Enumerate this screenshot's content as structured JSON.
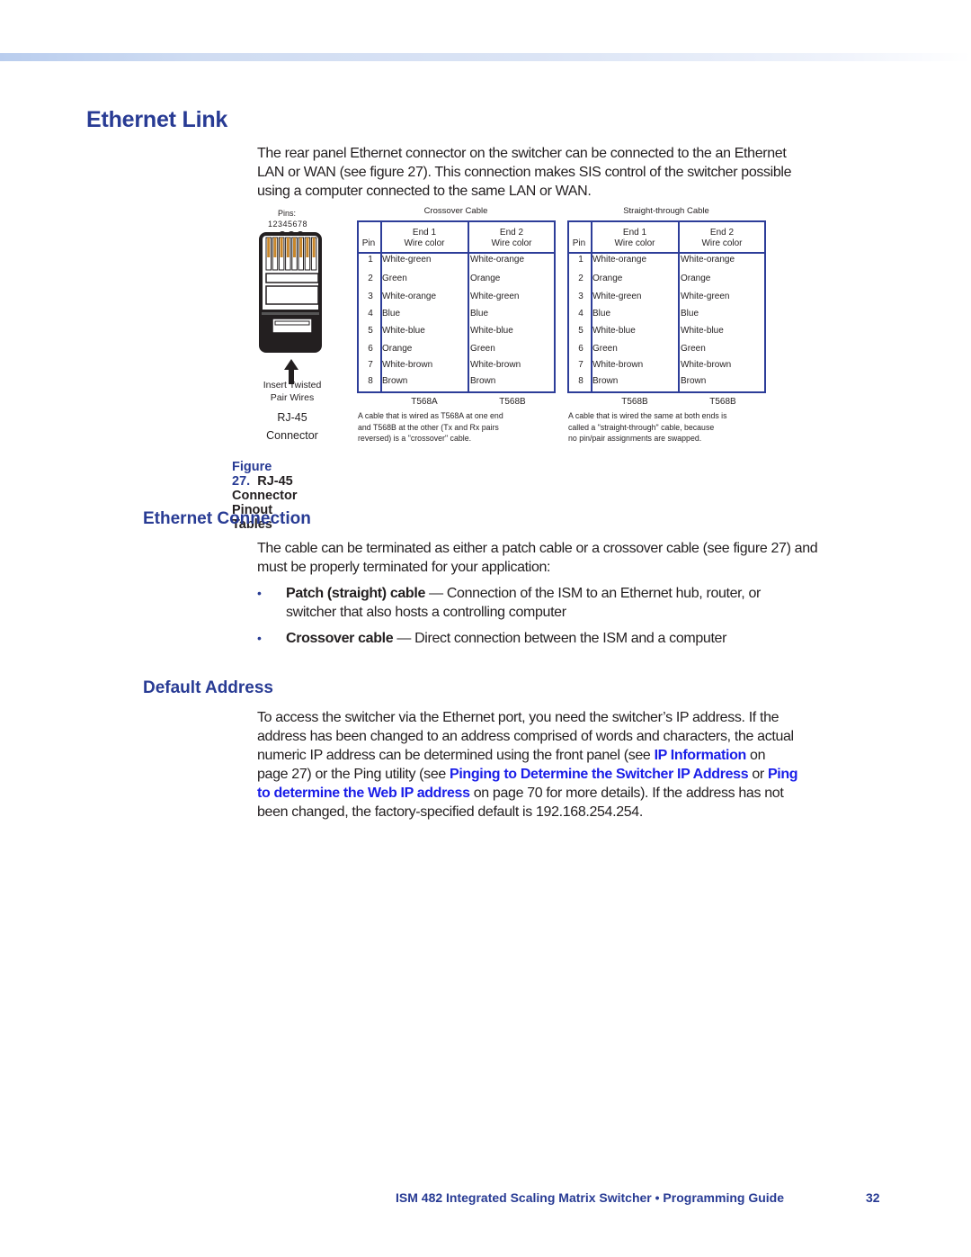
{
  "header": {
    "band": "gradient-band"
  },
  "section": {
    "title": "Ethernet Link",
    "intro": [
      "The rear panel Ethernet connector on the switcher can be connected to the an Ethernet",
      "LAN or WAN (see figure 27).  This connection makes SIS control of the switcher possible",
      "using a computer connected to the same LAN or WAN."
    ]
  },
  "figure": {
    "connector": {
      "pins_label": "Pins:",
      "pin_numbers": "12345678",
      "insert_label_1": "Insert Twisted",
      "insert_label_2": "Pair Wires",
      "name_1": "RJ-45",
      "name_2": "Connector",
      "pin_wire_color": "#c8862a"
    },
    "tables": [
      {
        "title": "Crossover Cable",
        "headers": {
          "pin": "Pin",
          "end1_a": "End 1",
          "end1_b": "Wire color",
          "end2_a": "End 2",
          "end2_b": "Wire color"
        },
        "rows": [
          {
            "pin": "1",
            "end1": "White-green",
            "end2": "White-orange"
          },
          {
            "pin": "2",
            "end1": "Green",
            "end2": "Orange"
          },
          {
            "pin": "3",
            "end1": "White-orange",
            "end2": "White-green"
          },
          {
            "pin": "4",
            "end1": "Blue",
            "end2": "Blue"
          },
          {
            "pin": "5",
            "end1": "White-blue",
            "end2": "White-blue"
          },
          {
            "pin": "6",
            "end1": "Orange",
            "end2": "Green"
          },
          {
            "pin": "7",
            "end1": "White-brown",
            "end2": "White-brown"
          },
          {
            "pin": "8",
            "end1": "Brown",
            "end2": "Brown"
          }
        ],
        "standard_end1": "T568A",
        "standard_end2": "T568B",
        "note": [
          "A cable that is wired as T568A at one end",
          "and T568B at the other (Tx and Rx pairs",
          "reversed) is a \"crossover\" cable."
        ]
      },
      {
        "title": "Straight-through Cable",
        "headers": {
          "pin": "Pin",
          "end1_a": "End 1",
          "end1_b": "Wire color",
          "end2_a": "End 2",
          "end2_b": "Wire color"
        },
        "rows": [
          {
            "pin": "1",
            "end1": "White-orange",
            "end2": "White-orange"
          },
          {
            "pin": "2",
            "end1": "Orange",
            "end2": "Orange"
          },
          {
            "pin": "3",
            "end1": "White-green",
            "end2": "White-green"
          },
          {
            "pin": "4",
            "end1": "Blue",
            "end2": "Blue"
          },
          {
            "pin": "5",
            "end1": "White-blue",
            "end2": "White-blue"
          },
          {
            "pin": "6",
            "end1": "Green",
            "end2": "Green"
          },
          {
            "pin": "7",
            "end1": "White-brown",
            "end2": "White-brown"
          },
          {
            "pin": "8",
            "end1": "Brown",
            "end2": "Brown"
          }
        ],
        "standard_end1": "T568B",
        "standard_end2": "T568B",
        "note": [
          "A cable that is wired the same at both ends is",
          "called a \"straight-through\" cable, because",
          "no pin/pair assignments are swapped."
        ]
      }
    ],
    "caption_number": "Figure 27.",
    "caption_title": "RJ-45 Connector Pinout Tables"
  },
  "ethernet_connection": {
    "title": "Ethernet Connection",
    "intro": [
      "The cable can be terminated as either a patch cable or a crossover cable (see figure 27) and",
      "must be properly terminated for your application:"
    ],
    "bullets": [
      {
        "term": "Patch (straight) cable",
        "line1": " — Connection of the ISM to an Ethernet hub, router, or",
        "line2": "switcher that also hosts a controlling computer"
      },
      {
        "term": "Crossover cable",
        "line1": " — Direct connection between the ISM and a computer",
        "line2": ""
      }
    ],
    "bullet_char": "•"
  },
  "default_address": {
    "title": "Default Address",
    "line1": "To access the switcher via the Ethernet port, you need the switcher’s IP address.  If the",
    "line2": "address has been changed to an address comprised of words and characters, the actual",
    "line3_pre": "numeric IP address can be determined using the front panel (see ",
    "link_ip_info": "IP Information",
    "line3_post": " on",
    "line4_pre": "page 27) or the Ping utility (see ",
    "link_pinging": "Pinging to Determine the Switcher IP Address",
    "line4_mid": " or ",
    "link_ping_a": "Ping",
    "link_ping_b": "to determine the Web IP address",
    "line5_post": " on page 70 for more details).  If the address has not",
    "line6": "been changed, the factory-specified default is 192.168.254.254."
  },
  "footer": {
    "title": "ISM 482 Integrated Scaling Matrix Switcher • Programming Guide",
    "page": "32"
  }
}
